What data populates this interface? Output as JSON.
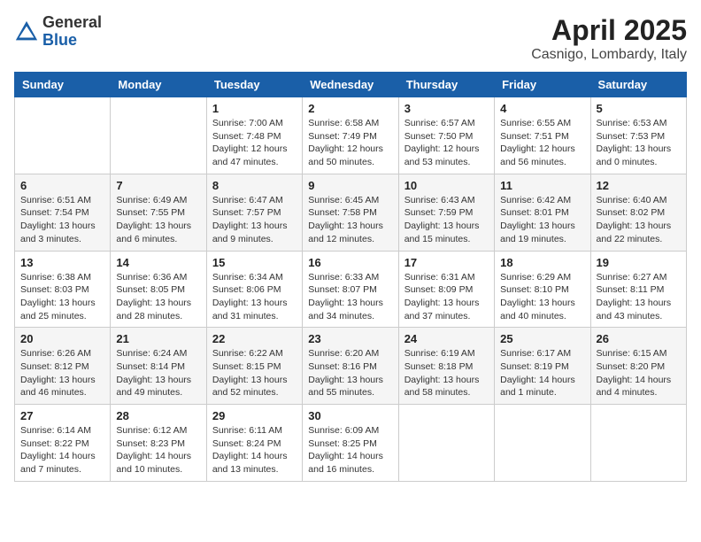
{
  "logo": {
    "general": "General",
    "blue": "Blue"
  },
  "title": "April 2025",
  "subtitle": "Casnigo, Lombardy, Italy",
  "days_header": [
    "Sunday",
    "Monday",
    "Tuesday",
    "Wednesday",
    "Thursday",
    "Friday",
    "Saturday"
  ],
  "weeks": [
    [
      {
        "day": "",
        "info": ""
      },
      {
        "day": "",
        "info": ""
      },
      {
        "day": "1",
        "info": "Sunrise: 7:00 AM\nSunset: 7:48 PM\nDaylight: 12 hours\nand 47 minutes."
      },
      {
        "day": "2",
        "info": "Sunrise: 6:58 AM\nSunset: 7:49 PM\nDaylight: 12 hours\nand 50 minutes."
      },
      {
        "day": "3",
        "info": "Sunrise: 6:57 AM\nSunset: 7:50 PM\nDaylight: 12 hours\nand 53 minutes."
      },
      {
        "day": "4",
        "info": "Sunrise: 6:55 AM\nSunset: 7:51 PM\nDaylight: 12 hours\nand 56 minutes."
      },
      {
        "day": "5",
        "info": "Sunrise: 6:53 AM\nSunset: 7:53 PM\nDaylight: 13 hours\nand 0 minutes."
      }
    ],
    [
      {
        "day": "6",
        "info": "Sunrise: 6:51 AM\nSunset: 7:54 PM\nDaylight: 13 hours\nand 3 minutes."
      },
      {
        "day": "7",
        "info": "Sunrise: 6:49 AM\nSunset: 7:55 PM\nDaylight: 13 hours\nand 6 minutes."
      },
      {
        "day": "8",
        "info": "Sunrise: 6:47 AM\nSunset: 7:57 PM\nDaylight: 13 hours\nand 9 minutes."
      },
      {
        "day": "9",
        "info": "Sunrise: 6:45 AM\nSunset: 7:58 PM\nDaylight: 13 hours\nand 12 minutes."
      },
      {
        "day": "10",
        "info": "Sunrise: 6:43 AM\nSunset: 7:59 PM\nDaylight: 13 hours\nand 15 minutes."
      },
      {
        "day": "11",
        "info": "Sunrise: 6:42 AM\nSunset: 8:01 PM\nDaylight: 13 hours\nand 19 minutes."
      },
      {
        "day": "12",
        "info": "Sunrise: 6:40 AM\nSunset: 8:02 PM\nDaylight: 13 hours\nand 22 minutes."
      }
    ],
    [
      {
        "day": "13",
        "info": "Sunrise: 6:38 AM\nSunset: 8:03 PM\nDaylight: 13 hours\nand 25 minutes."
      },
      {
        "day": "14",
        "info": "Sunrise: 6:36 AM\nSunset: 8:05 PM\nDaylight: 13 hours\nand 28 minutes."
      },
      {
        "day": "15",
        "info": "Sunrise: 6:34 AM\nSunset: 8:06 PM\nDaylight: 13 hours\nand 31 minutes."
      },
      {
        "day": "16",
        "info": "Sunrise: 6:33 AM\nSunset: 8:07 PM\nDaylight: 13 hours\nand 34 minutes."
      },
      {
        "day": "17",
        "info": "Sunrise: 6:31 AM\nSunset: 8:09 PM\nDaylight: 13 hours\nand 37 minutes."
      },
      {
        "day": "18",
        "info": "Sunrise: 6:29 AM\nSunset: 8:10 PM\nDaylight: 13 hours\nand 40 minutes."
      },
      {
        "day": "19",
        "info": "Sunrise: 6:27 AM\nSunset: 8:11 PM\nDaylight: 13 hours\nand 43 minutes."
      }
    ],
    [
      {
        "day": "20",
        "info": "Sunrise: 6:26 AM\nSunset: 8:12 PM\nDaylight: 13 hours\nand 46 minutes."
      },
      {
        "day": "21",
        "info": "Sunrise: 6:24 AM\nSunset: 8:14 PM\nDaylight: 13 hours\nand 49 minutes."
      },
      {
        "day": "22",
        "info": "Sunrise: 6:22 AM\nSunset: 8:15 PM\nDaylight: 13 hours\nand 52 minutes."
      },
      {
        "day": "23",
        "info": "Sunrise: 6:20 AM\nSunset: 8:16 PM\nDaylight: 13 hours\nand 55 minutes."
      },
      {
        "day": "24",
        "info": "Sunrise: 6:19 AM\nSunset: 8:18 PM\nDaylight: 13 hours\nand 58 minutes."
      },
      {
        "day": "25",
        "info": "Sunrise: 6:17 AM\nSunset: 8:19 PM\nDaylight: 14 hours\nand 1 minute."
      },
      {
        "day": "26",
        "info": "Sunrise: 6:15 AM\nSunset: 8:20 PM\nDaylight: 14 hours\nand 4 minutes."
      }
    ],
    [
      {
        "day": "27",
        "info": "Sunrise: 6:14 AM\nSunset: 8:22 PM\nDaylight: 14 hours\nand 7 minutes."
      },
      {
        "day": "28",
        "info": "Sunrise: 6:12 AM\nSunset: 8:23 PM\nDaylight: 14 hours\nand 10 minutes."
      },
      {
        "day": "29",
        "info": "Sunrise: 6:11 AM\nSunset: 8:24 PM\nDaylight: 14 hours\nand 13 minutes."
      },
      {
        "day": "30",
        "info": "Sunrise: 6:09 AM\nSunset: 8:25 PM\nDaylight: 14 hours\nand 16 minutes."
      },
      {
        "day": "",
        "info": ""
      },
      {
        "day": "",
        "info": ""
      },
      {
        "day": "",
        "info": ""
      }
    ]
  ]
}
